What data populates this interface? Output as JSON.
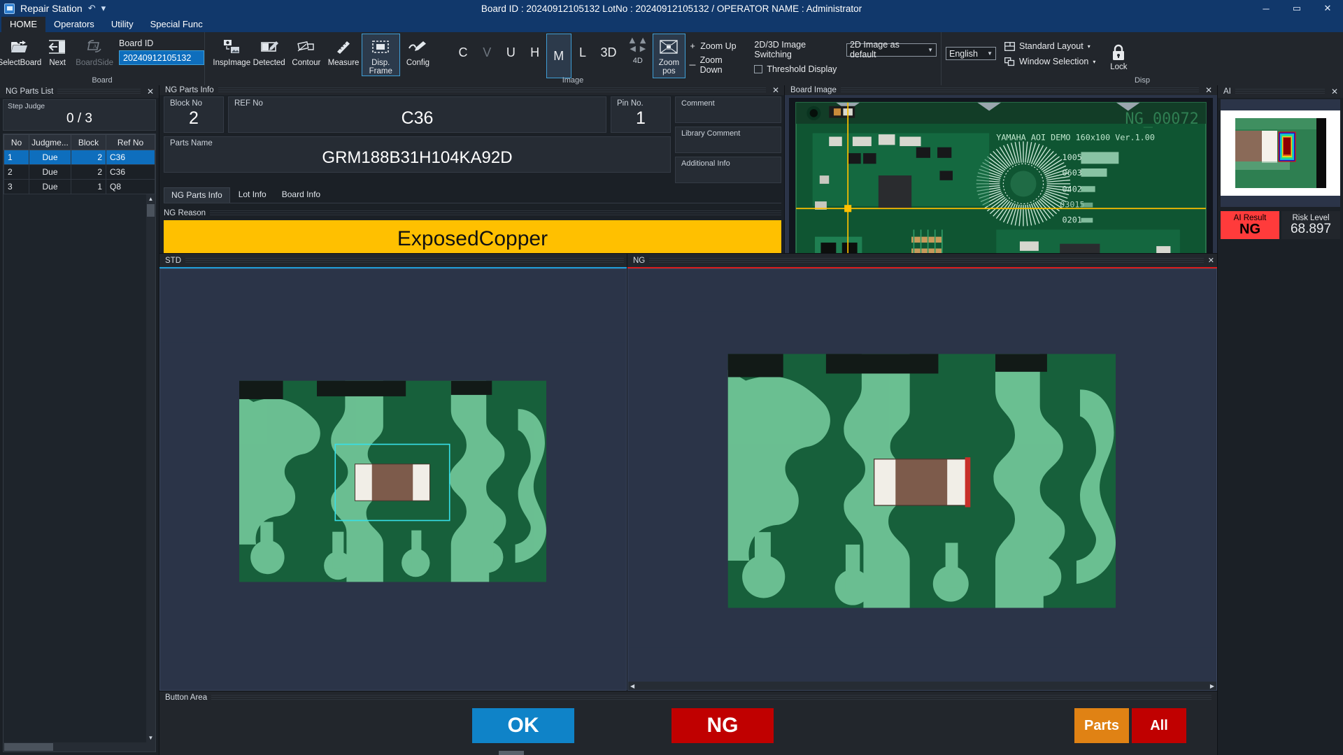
{
  "app": {
    "name": "Repair Station",
    "title": "Board ID : 20240912105132 LotNo : 20240912105132 / OPERATOR NAME : Administrator",
    "quick_access": {
      "undo": "↶",
      "more": "▾"
    },
    "window_controls": {
      "minimize": "─",
      "maximize": "▭",
      "close": "✕"
    }
  },
  "menu": {
    "tabs": [
      "HOME",
      "Operators",
      "Utility",
      "Special Func"
    ],
    "active": "HOME"
  },
  "ribbon": {
    "groups": [
      {
        "label": "Board",
        "buttons": [
          {
            "name": "select-board",
            "label": "SelectBoard",
            "icon": "open-folder-icon",
            "disabled": false
          },
          {
            "name": "next",
            "label": "Next",
            "icon": "next-arrow-icon",
            "disabled": false
          },
          {
            "name": "board-side",
            "label": "BoardSide",
            "icon": "flip-board-icon",
            "disabled": true
          }
        ],
        "board_id": {
          "label": "Board ID",
          "value": "20240912105132"
        }
      },
      {
        "label": "Image",
        "buttons": [
          {
            "name": "insp-image",
            "label": "InspImage",
            "icon": "camera-image-icon",
            "selected": false
          },
          {
            "name": "detected",
            "label": "Detected",
            "icon": "detected-pen-icon",
            "selected": false
          },
          {
            "name": "contour",
            "label": "Contour",
            "icon": "contour-icon",
            "selected": false
          },
          {
            "name": "measure",
            "label": "Measure",
            "icon": "ruler-icon",
            "selected": false
          },
          {
            "name": "disp-frame",
            "label": "Disp. Frame",
            "icon": "frame-icon",
            "selected": true
          },
          {
            "name": "config",
            "label": "Config",
            "icon": "config-pen-icon",
            "selected": false
          }
        ],
        "letters": [
          {
            "name": "letter-c",
            "label": "C",
            "selected": false,
            "dim": false
          },
          {
            "name": "letter-v",
            "label": "V",
            "selected": false,
            "dim": true
          },
          {
            "name": "letter-u",
            "label": "U",
            "selected": false,
            "dim": false
          },
          {
            "name": "letter-h",
            "label": "H",
            "selected": false,
            "dim": false
          },
          {
            "name": "letter-m",
            "label": "M",
            "selected": true,
            "dim": false
          },
          {
            "name": "letter-l",
            "label": "L",
            "selected": false,
            "dim": false
          },
          {
            "name": "letter-3d",
            "label": "3D",
            "selected": false,
            "dim": false
          }
        ],
        "fourd": {
          "label": "4D",
          "arrows": [
            "◀",
            "▶",
            "◀",
            "▶"
          ]
        },
        "zoom_pos": {
          "label_top": "Zoom",
          "label_bottom": "pos",
          "icon": "zoom-position-icon"
        },
        "zoom_up": {
          "sign": "+",
          "label": "Zoom Up"
        },
        "zoom_down": {
          "sign": "─",
          "label": "Zoom Down"
        },
        "switching_label": "2D/3D Image Switching",
        "switching_value": "2D Image as default",
        "threshold_display": {
          "label": "Threshold Display",
          "checked": false
        }
      },
      {
        "label": "Disp",
        "language": "English",
        "items": [
          {
            "name": "standard-layout",
            "label": "Standard Layout",
            "icon": "layout-icon",
            "caret": "▾"
          },
          {
            "name": "window-selection",
            "label": "Window Selection",
            "icon": "windows-icon",
            "caret": "▾"
          }
        ],
        "lock": {
          "label": "Lock",
          "icon": "lock-icon"
        }
      }
    ]
  },
  "ng_parts_list": {
    "title": "NG Parts List",
    "close": "✕",
    "step_judge": {
      "label": "Step Judge",
      "value": "0 / 3"
    },
    "columns": [
      "No",
      "Judgme...",
      "Block",
      "Ref No"
    ],
    "rows": [
      {
        "no": "1",
        "judgement": "Due",
        "block": "2",
        "ref_no": "C36",
        "selected": true
      },
      {
        "no": "2",
        "judgement": "Due",
        "block": "2",
        "ref_no": "C36",
        "selected": false
      },
      {
        "no": "3",
        "judgement": "Due",
        "block": "1",
        "ref_no": "Q8",
        "selected": false
      }
    ]
  },
  "ng_parts_info": {
    "title": "NG Parts Info",
    "close": "✕",
    "block_no": {
      "label": "Block No",
      "value": "2"
    },
    "ref_no": {
      "label": "REF No",
      "value": "C36"
    },
    "pin_no": {
      "label": "Pin No.",
      "value": "1"
    },
    "parts_name": {
      "label": "Parts Name",
      "value": "GRM188B31H104KA92D"
    },
    "comment": {
      "label": "Comment",
      "value": ""
    },
    "library_comment": {
      "label": "Library Comment",
      "value": ""
    },
    "additional_info": {
      "label": "Additional Info",
      "value": ""
    },
    "tabs": [
      "NG Parts Info",
      "Lot Info",
      "Board Info"
    ],
    "active_tab": "NG Parts Info",
    "ng_reason": {
      "label": "NG Reason",
      "value": "ExposedCopper"
    }
  },
  "board_image": {
    "title": "Board Image",
    "close": "✕",
    "overlay_id": "NG_00072",
    "silk_text": "YAMAHA AOI DEMO 160x100 Ver.1.00",
    "pad_labels": [
      "1005",
      "0603",
      "0402",
      "03015",
      "0201"
    ]
  },
  "viewers": {
    "std": {
      "title": "STD",
      "accent": "#1f9cd6"
    },
    "ng": {
      "title": "NG",
      "accent": "#d81d1d",
      "close": "✕"
    }
  },
  "button_area": {
    "title": "Button Area",
    "buttons": [
      {
        "name": "ok-button",
        "label": "OK",
        "color": "#0f83c8"
      },
      {
        "name": "ng-button",
        "label": "NG",
        "color": "#c00000"
      },
      {
        "name": "parts-button",
        "label": "Parts",
        "color": "#e08214"
      },
      {
        "name": "all-button",
        "label": "All",
        "color": "#c00000"
      }
    ]
  },
  "ai_panel": {
    "title": "AI",
    "close": "✕",
    "result": {
      "label": "AI Result",
      "value": "NG",
      "color": "#ff3b3b"
    },
    "risk": {
      "label": "Risk Level",
      "value": "68.897"
    }
  }
}
